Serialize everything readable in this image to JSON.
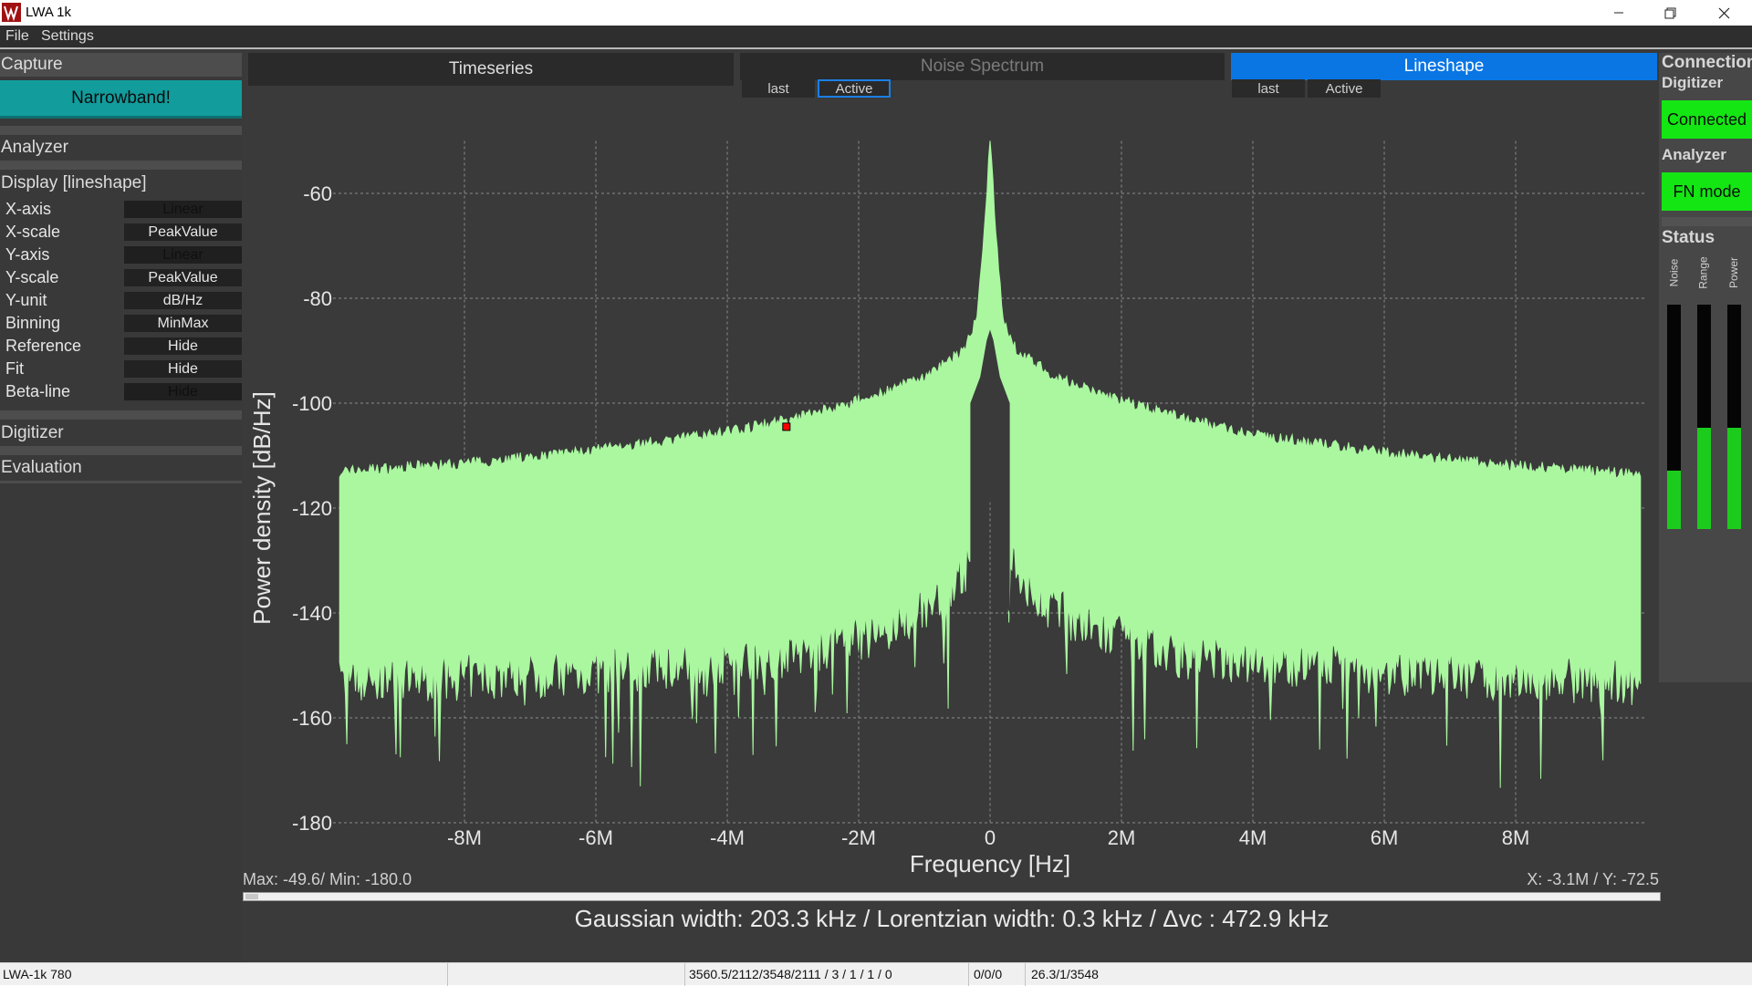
{
  "window": {
    "title": "LWA 1k"
  },
  "menu": {
    "file": "File",
    "settings": "Settings"
  },
  "left_panel": {
    "capture_header": "Capture",
    "capture_button": "Narrowband!",
    "analyzer_header": "Analyzer",
    "display_header": "Display [lineshape]",
    "settings": [
      {
        "label": "X-axis",
        "value": "Linear"
      },
      {
        "label": "X-scale",
        "value": "PeakValue"
      },
      {
        "label": "Y-axis",
        "value": "Linear"
      },
      {
        "label": "Y-scale",
        "value": "PeakValue"
      },
      {
        "label": "Y-unit",
        "value": "dB/Hz"
      },
      {
        "label": "Binning",
        "value": "MinMax"
      },
      {
        "label": "Reference",
        "value": "Hide"
      },
      {
        "label": "Fit",
        "value": "Hide"
      },
      {
        "label": "Beta-line",
        "value": "Hide"
      }
    ],
    "digitizer_header": "Digitizer",
    "evaluation_header": "Evaluation"
  },
  "tabs": {
    "timeseries": "Timeseries",
    "noise_spectrum": "Noise Spectrum",
    "noise_last": "last",
    "noise_active": "Active",
    "lineshape": "Lineshape",
    "lineshape_last": "last",
    "lineshape_active": "Active"
  },
  "plot": {
    "max_min": "Max: -49.6/ Min: -180.0",
    "cursor": "X: -3.1M / Y: -72.5",
    "result": "Gaussian width: 203.3 kHz / Lorentzian width: 0.3 kHz  / Δvc : 472.9 kHz"
  },
  "chart_data": {
    "type": "area",
    "xlabel": "Frequency [Hz]",
    "ylabel": "Power density [dB/Hz]",
    "xlim": [
      -10000000,
      10000000
    ],
    "ylim": [
      -180,
      -50
    ],
    "xticks": [
      -8000000,
      -6000000,
      -4000000,
      -2000000,
      0,
      2000000,
      4000000,
      6000000,
      8000000
    ],
    "xtick_labels": [
      "-8M",
      "-6M",
      "-4M",
      "-2M",
      "0",
      "2M",
      "4M",
      "6M",
      "8M"
    ],
    "yticks": [
      -60,
      -80,
      -100,
      -120,
      -140,
      -160,
      -180
    ],
    "ytick_labels": [
      "-60",
      "-80",
      "-100",
      "-120",
      "-140",
      "-160",
      "-180"
    ],
    "grid": true,
    "series": [
      {
        "color": "#aaf7a0",
        "upper_x": [
          -9900000,
          -8000000,
          -6000000,
          -4000000,
          -3000000,
          -2000000,
          -1500000,
          -1000000,
          -700000,
          -400000,
          -200000,
          -100000,
          0,
          100000,
          200000,
          400000,
          700000,
          1000000,
          1500000,
          2000000,
          3000000,
          4000000,
          6000000,
          8000000,
          9900000
        ],
        "upper_y": [
          -113,
          -111.5,
          -109,
          -105.5,
          -103,
          -99.5,
          -97.5,
          -95,
          -92.5,
          -90,
          -84,
          -70,
          -49.6,
          -70,
          -84,
          -90,
          -92.5,
          -95,
          -97.5,
          -99.5,
          -103,
          -106,
          -109.5,
          -112,
          -113.5
        ],
        "lower_x": [
          -9900000,
          -6000000,
          -3000000,
          -1500000,
          -600000,
          -300000,
          -50000,
          0,
          50000,
          300000,
          600000,
          1500000,
          3000000,
          6000000,
          9900000
        ],
        "lower_y": [
          -155,
          -153,
          -150,
          -145,
          -138,
          -130,
          -110,
          -90,
          -110,
          -130,
          -138,
          -145,
          -150,
          -153,
          -155
        ],
        "dark_core_x": [
          -300000,
          -150000,
          -50000,
          0,
          50000,
          150000,
          300000
        ],
        "dark_core_top": [
          -100,
          -95,
          -88,
          -86,
          -88,
          -95,
          -100
        ],
        "dark_core_bottom": [
          -140,
          -136,
          -128,
          -118,
          -128,
          -136,
          -140
        ]
      }
    ],
    "marker": {
      "x": -3100000,
      "y": -104.5,
      "color": "#ff0000"
    }
  },
  "right_panel": {
    "connection_header": "Connection",
    "digitizer_header": "Digitizer",
    "connected_button": "Connected",
    "analyzer_header": "Analyzer",
    "fn_mode_button": "FN mode",
    "status_header": "Status",
    "meters": [
      {
        "label": "Noise",
        "level": 0.26
      },
      {
        "label": "Range",
        "level": 0.45
      },
      {
        "label": "Power",
        "level": 0.45
      }
    ]
  },
  "statusbar": {
    "device": "LWA-1k 780",
    "counters": "3560.5/2112/3548/2111 / 3 / 1 / 1 / 0",
    "errors": "0/0/0",
    "extra": "26.3/1/3548"
  }
}
